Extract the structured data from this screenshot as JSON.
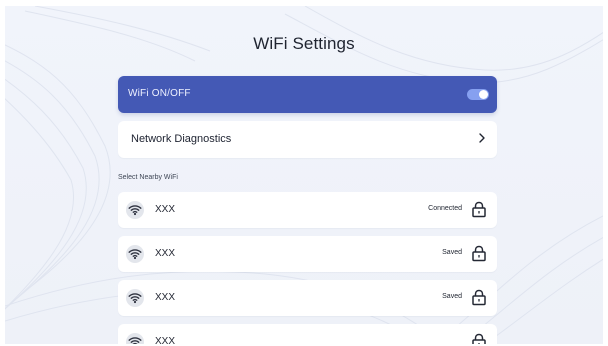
{
  "page": {
    "title": "WiFi Settings"
  },
  "wifi_toggle": {
    "label": "WiFi ON/OFF",
    "state": "on",
    "accent_color": "#4459b5"
  },
  "diagnostics": {
    "label": "Network Diagnostics",
    "icon": "chevron-right-icon"
  },
  "nearby": {
    "section_label": "Select Nearby WiFi",
    "networks": [
      {
        "name": "XXX",
        "status": "Connected",
        "icon": "wifi-icon",
        "lock_icon": "lock-icon"
      },
      {
        "name": "XXX",
        "status": "Saved",
        "icon": "wifi-icon",
        "lock_icon": "lock-icon"
      },
      {
        "name": "XXX",
        "status": "Saved",
        "icon": "wifi-icon",
        "lock_icon": "lock-icon"
      },
      {
        "name": "XXX",
        "status": "",
        "icon": "wifi-icon",
        "lock_icon": "lock-icon"
      }
    ]
  }
}
